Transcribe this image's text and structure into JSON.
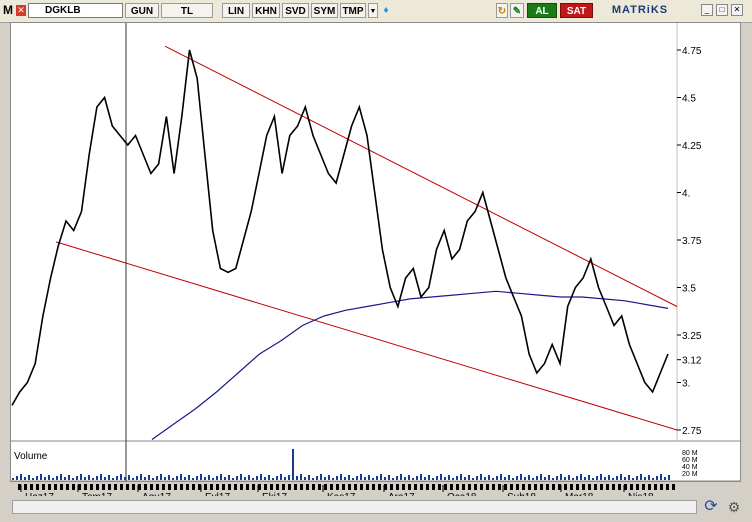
{
  "toolbar": {
    "symbol": "DGKLB",
    "buttons": [
      "GUN",
      "TL",
      "LIN",
      "KHN",
      "SVD",
      "SYM",
      "TMP"
    ],
    "al_label": "AL",
    "sat_label": "SAT",
    "brand": "MATRiKS"
  },
  "volume_panel": {
    "label": "Volume",
    "scale": [
      "80 M",
      "60 M",
      "40 M",
      "20 M"
    ]
  },
  "colors": {
    "price_line": "#000000",
    "trend_lines": "#c00000",
    "moving_average": "#1a1a8a",
    "volume": "#1a3a8a"
  },
  "chart_data": {
    "type": "line",
    "title": "",
    "xlabel": "",
    "ylabel": "",
    "ylim": [
      2.7,
      4.85
    ],
    "y_ticks": [
      4.75,
      4.5,
      4.25,
      4,
      3.75,
      3.5,
      3.25,
      3.12,
      3
    ],
    "y_tick_labels": [
      "4.75",
      "4.5",
      "4.25",
      "4.",
      "3.75",
      "3.5",
      "3.25",
      "3.12",
      "3.",
      "2.75"
    ],
    "x_ticks": [
      "Haz17",
      "Tem17",
      "Agu17",
      "Eyl17",
      "Eki17",
      "Kas17",
      "Ara17",
      "Oca18",
      "Sub18",
      "Mar18",
      "Nis18"
    ],
    "series": [
      {
        "values": [
          2.88,
          2.95,
          3.0,
          3.1,
          3.35,
          3.55,
          3.72,
          3.85,
          3.8,
          3.9,
          4.2,
          4.45,
          4.5,
          4.35,
          4.3,
          4.25,
          4.3,
          4.2,
          4.1,
          4.15,
          4.4,
          4.1,
          4.4,
          4.75,
          4.6,
          4.2,
          3.8,
          3.6,
          3.58,
          3.6,
          3.75,
          3.9,
          4.1,
          4.3,
          4.4,
          4.1,
          4.3,
          4.35,
          4.45,
          4.3,
          4.2,
          4.1,
          4.05,
          4.2,
          4.35,
          4.45,
          4.3,
          4.0,
          3.7,
          3.5,
          3.4,
          3.55,
          3.6,
          3.45,
          3.5,
          3.7,
          3.8,
          3.65,
          3.7,
          3.85,
          3.9,
          4.0,
          3.85,
          3.7,
          3.55,
          3.45,
          3.35,
          3.15,
          3.05,
          3.1,
          3.2,
          3.1,
          3.4,
          3.5,
          3.55,
          3.65,
          3.5,
          3.4,
          3.3,
          3.35,
          3.2,
          3.1,
          3.0,
          2.95,
          3.05,
          3.15
        ]
      },
      {
        "values": [
          2.7,
          2.78,
          2.86,
          2.95,
          3.05,
          3.15,
          3.22,
          3.3,
          3.35,
          3.38,
          3.4,
          3.42,
          3.44,
          3.45,
          3.46,
          3.47,
          3.48,
          3.47,
          3.46,
          3.45,
          3.45,
          3.44,
          3.43,
          3.41,
          3.39
        ]
      }
    ],
    "trend_lines": [
      {
        "from": [
          "Tem17",
          3.74
        ],
        "to": [
          "Nis18",
          2.75
        ]
      },
      {
        "from": [
          "Agu17",
          4.77
        ],
        "to": [
          "Nis18",
          3.4
        ]
      }
    ],
    "volume_spike_x": "Eki17",
    "grid": false,
    "legend": "none"
  }
}
